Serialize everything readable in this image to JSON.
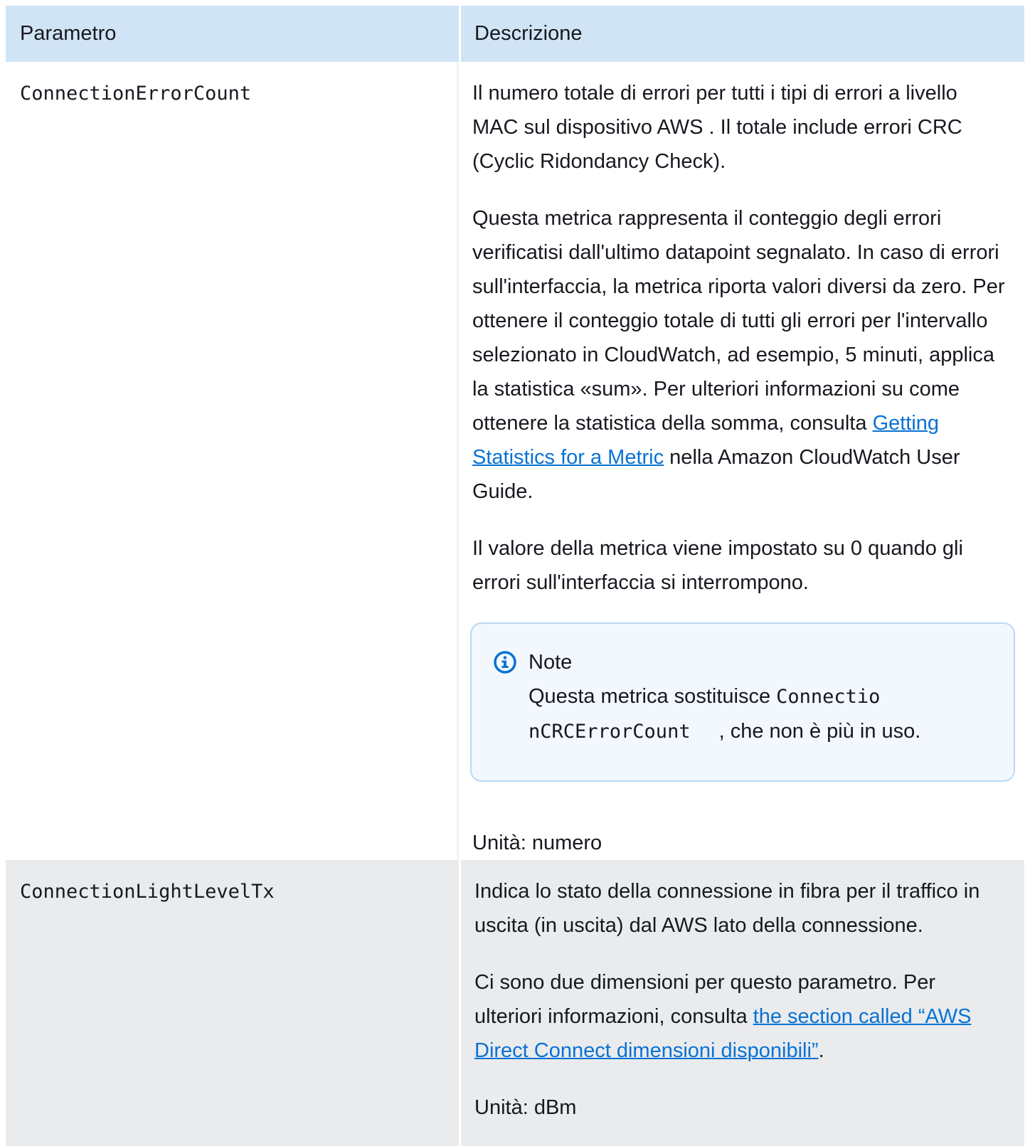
{
  "table": {
    "headers": {
      "parameter": "Parametro",
      "description": "Descrizione"
    },
    "rows": [
      {
        "name": "ConnectionErrorCount",
        "p1": "Il numero totale di errori per tutti i tipi di errori a livello MAC sul dispositivo AWS . Il totale include errori CRC (Cyclic Ridondancy Check).",
        "p2_before_link": "Questa metrica rappresenta il conteggio degli errori verificatisi dall'ultimo datapoint segnalato. In caso di errori sull'interfaccia, la metrica riporta valori diversi da zero. Per ottenere il conteggio totale di tutti gli errori per l'intervallo selezionato in CloudWatch, ad esempio, 5 minuti, applica la statistica «sum». Per ulteriori informazioni su come ottenere la statistica della somma, consulta ",
        "p2_link": "Getting Statistics for a Metric",
        "p2_after_link": " nella Amazon CloudWatch User Guide.",
        "p3": "Il valore della metrica viene impostato su 0 quando gli errori sull'interfaccia si interrompono.",
        "note": {
          "icon": "info-icon",
          "title": "Note",
          "text_before": "Questa metrica sostituisce ",
          "code_line1": "Connectio",
          "code_line2": "nCRCErrorCount",
          "text_after": ", che non è più in uso."
        },
        "unit": "Unità: numero"
      },
      {
        "name": "ConnectionLightLevelTx",
        "p1": "Indica lo stato della connessione in fibra per il traffico in uscita (in uscita) dal AWS lato della connessione.",
        "p2_before_link": "Ci sono due dimensioni per questo parametro. Per ulteriori informazioni, consulta ",
        "p2_link": "the section called “AWS Direct Connect dimensioni disponibili”",
        "p2_after_link": ".",
        "unit": "Unità: dBm"
      }
    ]
  },
  "colors": {
    "header_bg": "#d1e4f6",
    "alt_row_bg": "#e9ebed",
    "link": "#0972d3",
    "note_border": "#b9d9f7",
    "note_bg": "#f2f8fd"
  }
}
